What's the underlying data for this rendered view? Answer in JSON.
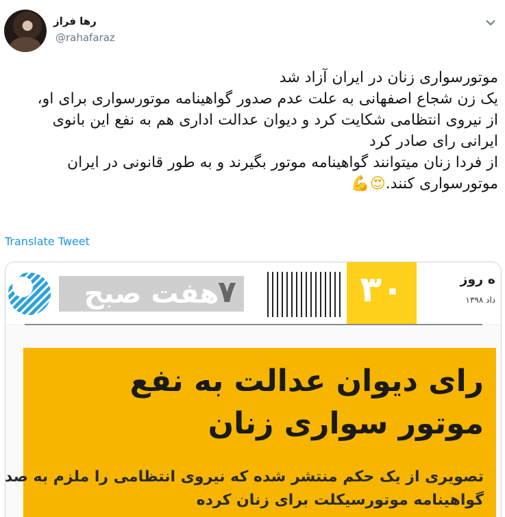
{
  "user": {
    "display_name": "رها فراز",
    "handle": "@rahafaraz"
  },
  "tweet": {
    "lines": [
      "موتورسواری زنان در ایران آزاد شد",
      "یک زن شجاع اصفهانی به علت عدم صدور گواهینامه موتورسواری برای او،",
      "از نیروی انتظامی شکایت کرد و دیوان عدالت اداری هم به نفع این بانوی",
      "ایرانی رای صادر کرد",
      "از فردا زنان میتوانند گواهینامه موتور بگیرند و به طور قانونی در ایران",
      "موتورسواری کنند."
    ],
    "emoji_1": "😍",
    "emoji_2": "💪",
    "translate_label": "Translate Tweet"
  },
  "icons": {
    "chevron": "chevron-down-icon",
    "heart_eyes": "heart-eyes-emoji-icon",
    "flexed_arm": "flexed-biceps-emoji-icon"
  },
  "newspaper": {
    "name": "هفت صبح",
    "number": "۷",
    "yellow_number": "۳۰",
    "date_day": "ه روز",
    "date_sub": "داد ۱۳۹۸",
    "headline_line_1": "رای دیوان عدالت به نفع",
    "headline_line_2": "موتور سواری زنان",
    "subhead_line_1": "تصویری از یک حکم منتشر شده که نیروی انتظامی را ملزم به صدور",
    "subhead_line_2": "گواهینامه موتورسیکلت برای زنان کرده"
  },
  "colors": {
    "link": "#1b95e0",
    "handle": "#657786",
    "headline_bg": "#f7b500",
    "masthead_yellow": "#ffd11a"
  }
}
